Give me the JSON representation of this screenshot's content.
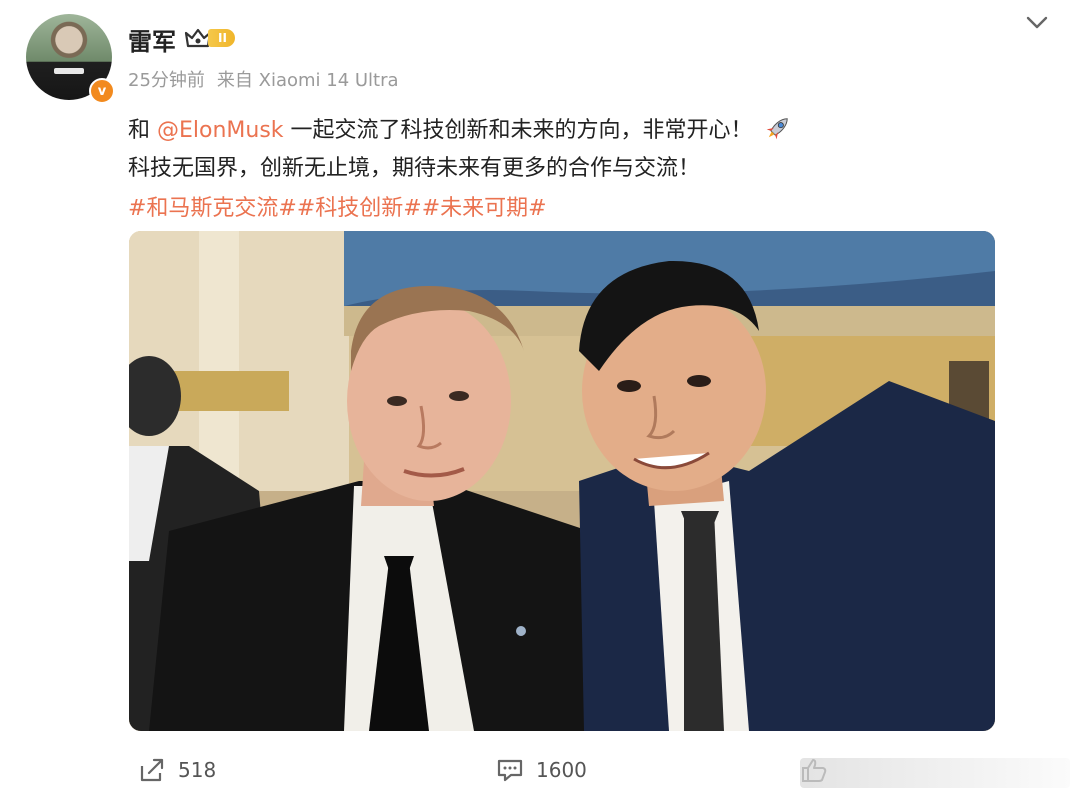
{
  "user": {
    "name": "雷军",
    "level": "II",
    "time": "25分钟前",
    "source": "来自 Xiaomi 14 Ultra",
    "verified_mark": "v"
  },
  "post": {
    "line1_before": "和 ",
    "mention": "@ElonMusk",
    "line1_after": " 一起交流了科技创新和未来的方向，非常开心！",
    "line2": "科技无国界，创新无止境，期待未来有更多的合作与交流！",
    "hashtags": "#和马斯克交流##科技创新##未来可期#"
  },
  "actions": {
    "share_count": "518",
    "comment_count": "1600"
  },
  "colors": {
    "accent": "#eb7350",
    "meta": "#9a9a9a",
    "badge": "#f0b52a"
  },
  "icons": [
    "crown-icon",
    "chevron-down-icon",
    "rocket-icon",
    "share-icon",
    "comment-icon",
    "like-icon"
  ]
}
